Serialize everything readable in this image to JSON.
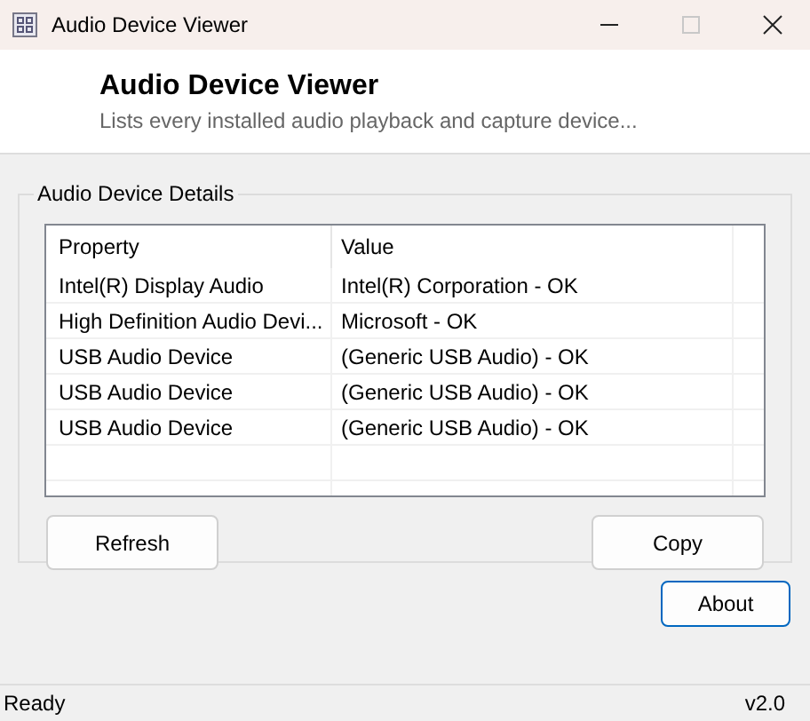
{
  "window": {
    "title": "Audio Device Viewer",
    "maximize_disabled": true
  },
  "header": {
    "title": "Audio Device Viewer",
    "subtitle": "Lists every installed audio playback and capture device..."
  },
  "group": {
    "label": "Audio Device Details",
    "table": {
      "columns": [
        "Property",
        "Value"
      ],
      "rows": [
        [
          "Intel(R) Display Audio",
          "Intel(R) Corporation - OK"
        ],
        [
          "High Definition Audio Devi...",
          "Microsoft - OK"
        ],
        [
          "USB Audio Device",
          "(Generic USB Audio) - OK"
        ],
        [
          "USB Audio Device",
          "(Generic USB Audio) - OK"
        ],
        [
          "USB Audio Device",
          "(Generic USB Audio) - OK"
        ]
      ]
    },
    "buttons": [
      {
        "label": "Refresh",
        "default": false
      },
      {
        "label": "Copy",
        "default": false
      }
    ]
  },
  "about_button": {
    "label": "About",
    "default": true
  },
  "status_bar": {
    "status": "Ready",
    "version": "v2.0"
  }
}
